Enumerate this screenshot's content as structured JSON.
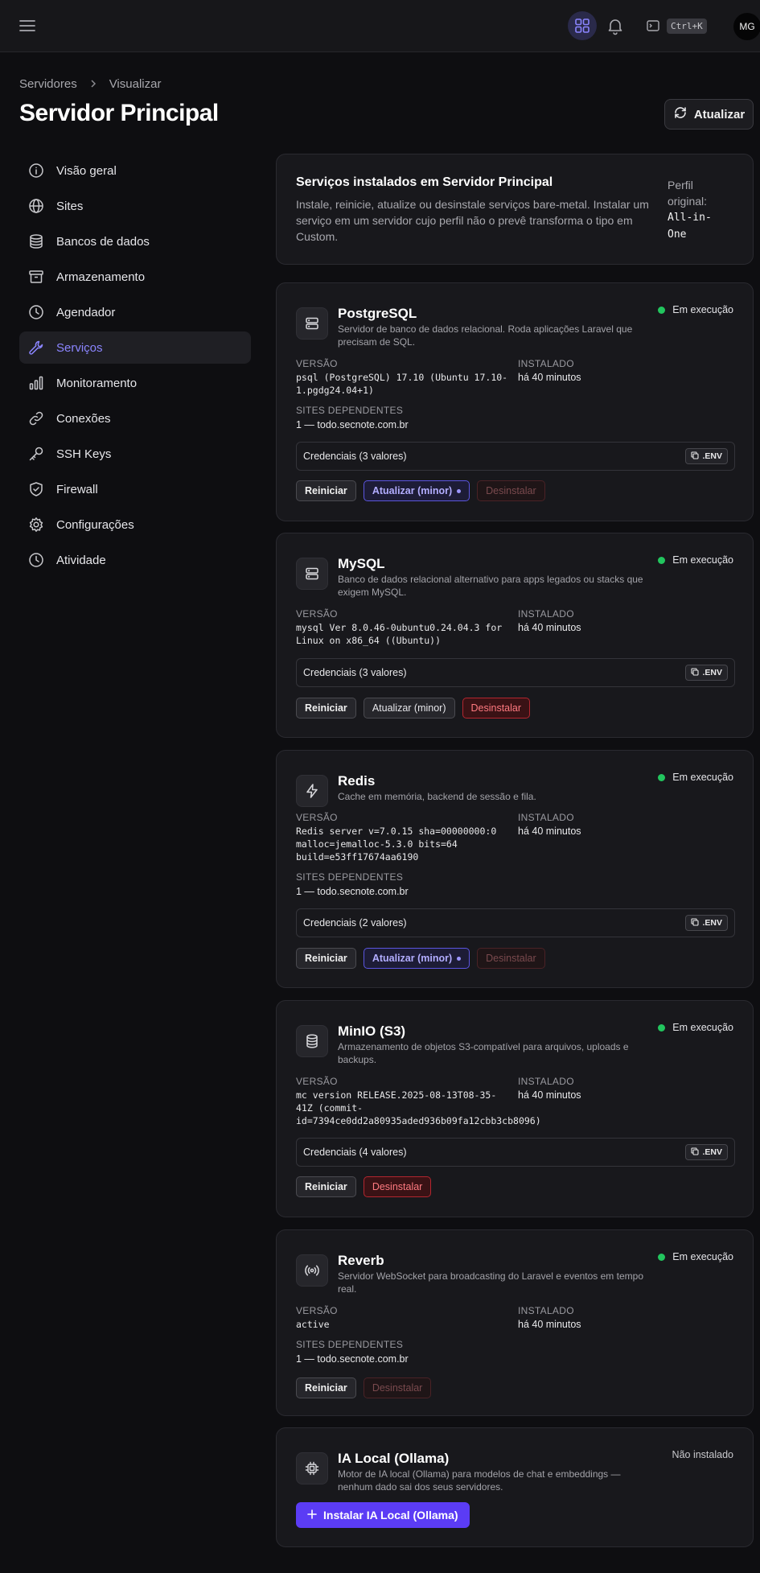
{
  "topbar": {
    "shortcut": "Ctrl+K",
    "avatar": "MG"
  },
  "breadcrumb": {
    "parent": "Servidores",
    "current": "Visualizar"
  },
  "page": {
    "title": "Servidor Principal",
    "refresh_label": "Atualizar"
  },
  "sidebar": {
    "items": [
      {
        "label": "Visão geral",
        "icon": "info-icon"
      },
      {
        "label": "Sites",
        "icon": "globe-icon"
      },
      {
        "label": "Bancos de dados",
        "icon": "database-icon"
      },
      {
        "label": "Armazenamento",
        "icon": "archive-icon"
      },
      {
        "label": "Agendador",
        "icon": "clock-icon"
      },
      {
        "label": "Serviços",
        "icon": "wrench-icon",
        "active": true
      },
      {
        "label": "Monitoramento",
        "icon": "bar-chart-icon"
      },
      {
        "label": "Conexões",
        "icon": "link-icon"
      },
      {
        "label": "SSH Keys",
        "icon": "key-icon"
      },
      {
        "label": "Firewall",
        "icon": "shield-icon"
      },
      {
        "label": "Configurações",
        "icon": "gear-icon"
      },
      {
        "label": "Atividade",
        "icon": "clock-icon"
      }
    ]
  },
  "header_card": {
    "title": "Serviços instalados em Servidor Principal",
    "description": "Instale, reinicie, atualize ou desinstale serviços bare-metal. Instalar um serviço em um servidor cujo perfil não o prevê transforma o tipo em Custom.",
    "perfil_label": "Perfil original:",
    "perfil_value": "All-in-One"
  },
  "labels": {
    "version": "VERSÃO",
    "installed": "INSTALADO",
    "dependents": "SITES DEPENDENTES",
    "env": ".ENV",
    "restart": "Reiniciar",
    "update_minor": "Atualizar (minor)",
    "uninstall": "Desinstalar",
    "running": "Em execução",
    "not_installed": "Não instalado"
  },
  "services": {
    "postgres": {
      "name": "PostgreSQL",
      "description": "Servidor de banco de dados relacional. Roda aplicações Laravel que precisam de SQL.",
      "version": "psql (PostgreSQL) 17.10 (Ubuntu 17.10-1.pgdg24.04+1)",
      "installed": "há 40 minutos",
      "dependents": "1 — todo.secnote.com.br",
      "credentials": "Credenciais (3 valores)"
    },
    "mysql": {
      "name": "MySQL",
      "description": "Banco de dados relacional alternativo para apps legados ou stacks que exigem MySQL.",
      "version": "mysql Ver 8.0.46-0ubuntu0.24.04.3 for Linux on x86_64 ((Ubuntu))",
      "installed": "há 40 minutos",
      "credentials": "Credenciais (3 valores)"
    },
    "redis": {
      "name": "Redis",
      "description": "Cache em memória, backend de sessão e fila.",
      "version": "Redis server v=7.0.15 sha=00000000:0 malloc=jemalloc-5.3.0 bits=64 build=e53ff17674aa6190",
      "installed": "há 40 minutos",
      "dependents": "1 — todo.secnote.com.br",
      "credentials": "Credenciais (2 valores)"
    },
    "minio": {
      "name": "MinIO (S3)",
      "description": "Armazenamento de objetos S3-compatível para arquivos, uploads e backups.",
      "version": "mc version RELEASE.2025-08-13T08-35-41Z (commit-id=7394ce0dd2a80935aded936b09fa12cbb3cb8096)",
      "installed": "há 40 minutos",
      "credentials": "Credenciais (4 valores)"
    },
    "reverb": {
      "name": "Reverb",
      "description": "Servidor WebSocket para broadcasting do Laravel e eventos em tempo real.",
      "version": "active",
      "installed": "há 40 minutos",
      "dependents": "1 — todo.secnote.com.br"
    },
    "ollama": {
      "name": "IA Local (Ollama)",
      "description": "Motor de IA local (Ollama) para modelos de chat e embeddings — nenhum dado sai dos seus servidores.",
      "install_label": "Instalar IA Local (Ollama)"
    }
  },
  "colors": {
    "accent": "#5b3cf5",
    "running": "#22c55e",
    "danger": "#b3262f"
  }
}
